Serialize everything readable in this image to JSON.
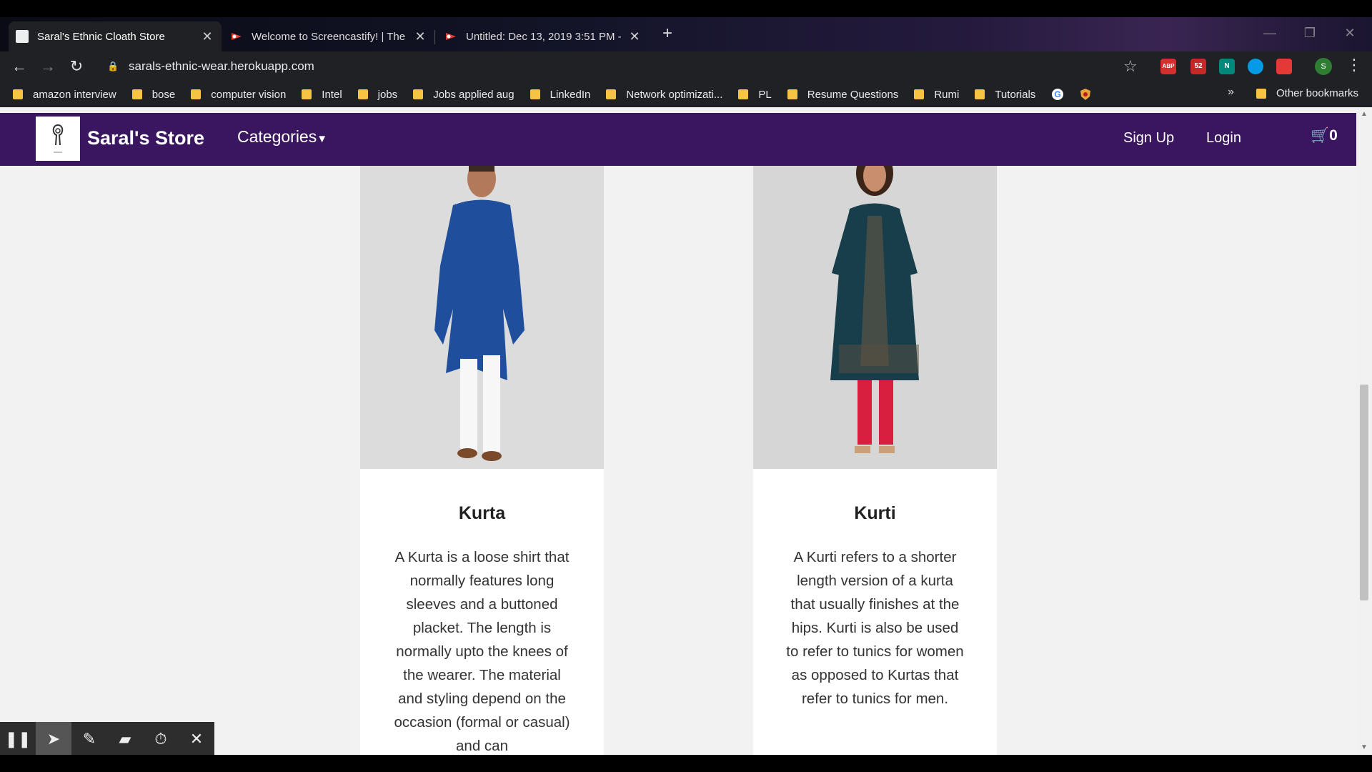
{
  "browser": {
    "tabs": [
      {
        "title": "Saral's Ethnic Cloath Store",
        "active": true
      },
      {
        "title": "Welcome to Screencastify! | The",
        "active": false
      },
      {
        "title": "Untitled: Dec 13, 2019 3:51 PM -",
        "active": false
      }
    ],
    "url": "sarals-ethnic-wear.herokuapp.com",
    "extensions": [
      {
        "label": "ABP",
        "color": "#d32f2f"
      },
      {
        "label": "52",
        "color": "#c62828"
      },
      {
        "label": "N",
        "color": "#00897b"
      },
      {
        "label": "",
        "color": "#039be5"
      },
      {
        "label": "",
        "color": "#e53935"
      }
    ],
    "profile_initial": "S",
    "bookmarks": [
      "amazon interview",
      "bose",
      "computer vision",
      "Intel",
      "jobs",
      "Jobs applied aug",
      "LinkedIn",
      "Network optimizati...",
      "PL",
      "Resume Questions",
      "Rumi",
      "Tutorials"
    ],
    "other_bookmarks": "Other bookmarks",
    "more_bookmarks": "»"
  },
  "site": {
    "brand": "Saral's Store",
    "categories": "Categories",
    "signup": "Sign Up",
    "login": "Login",
    "cart_count": "0"
  },
  "products": [
    {
      "name": "Kurta",
      "description": "A Kurta is a loose shirt that normally features long sleeves and a buttoned placket. The length is normally upto the knees of the wearer. The material and styling depend on the occasion (formal or casual) and can"
    },
    {
      "name": "Kurti",
      "description": "A Kurti refers to a shorter length version of a kurta that usually finishes at the hips. Kurti is also be used to refer to tunics for women as opposed to Kurtas that refer to tunics for men."
    }
  ],
  "icons": {
    "pause": "pause-icon",
    "cursor": "cursor-icon",
    "pen": "pen-icon",
    "eraser": "eraser-icon",
    "timer": "timer-icon",
    "close": "close-icon"
  }
}
